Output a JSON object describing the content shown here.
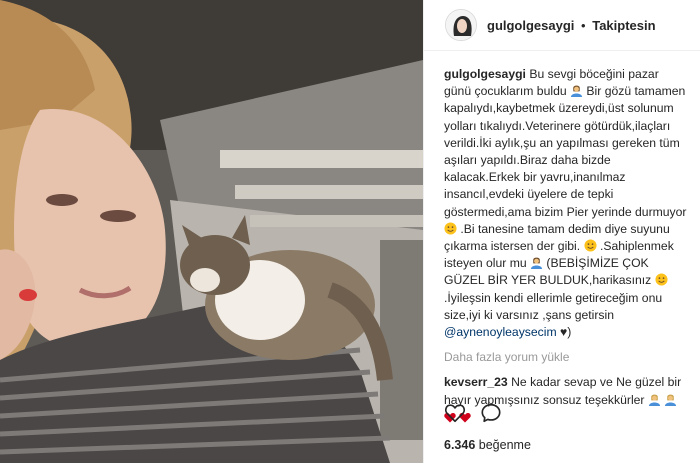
{
  "header": {
    "username": "gulgolgesaygi",
    "separator": "•",
    "follow_status": "Takiptesin"
  },
  "caption": {
    "username": "gulgolgesaygi",
    "parts": [
      "Bu sevgi böceğini pazar günü çocuklarım buldu",
      "Bir gözü tamamen kapalıydı,kaybetmek üzereydi,üst solunum yolları tıkalıydı.Veterinere götürdük,ilaçları verildi.İki aylık,şu an yapılması gereken tüm aşıları yapıldı.Biraz daha bizde kalacak.Erkek bir yavru,inanılmaz insancıl,evdeki üyelere de tepki göstermedi,ama bizim Pier yerinde durmuyor",
      ".Bi tanesine tamam dedim diye suyunu çıkarma istersen der gibi.",
      ".Sahiplenmek isteyen olur mu",
      "(BEBİŞİMİZE ÇOK GÜZEL BİR YER BULDUK,harikasınız",
      ".İyileşsin kendi ellerimle getireceğim onu size,iyi ki varsınız ,şans getirsin",
      "@aynenoyleaysecim",
      "♥)"
    ]
  },
  "load_more": "Daha fazla yorum yükle",
  "comments": [
    {
      "username": "kevserr_23",
      "text": "Ne kadar sevap ve Ne güzel bir hayır yapmışsınız sonsuz teşekkürler"
    }
  ],
  "likes": {
    "count": "6.346",
    "label": "beğenme"
  },
  "icons": {
    "like": "heart-icon",
    "comment": "comment-icon",
    "emoji_person": "person-emoji-icon",
    "emoji_smile": "smile-emoji-icon"
  },
  "colors": {
    "link": "#003569",
    "muted": "#999999",
    "text": "#262626",
    "heart": "#ed4956"
  }
}
